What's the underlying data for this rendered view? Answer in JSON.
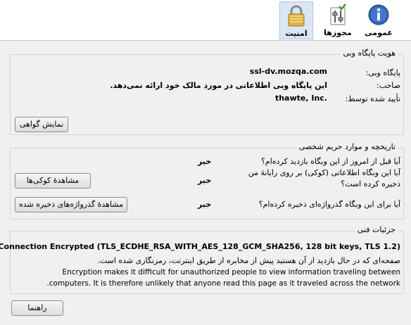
{
  "toolbar": {
    "general_label": "عمومی",
    "permissions_label": "مجوزها",
    "security_label": "امنیت"
  },
  "identity": {
    "legend": "هویت پایگاه وبی",
    "website_label": "پایگاه وبی:",
    "website_value": "ssl-dv.mozqa.com",
    "owner_label": "صاحب:",
    "owner_value": "این پایگاه وبی اطلاعاتی در مورد مالک خود ارائه نمی‌دهد.",
    "verified_label": "تأیید شده توسط:",
    "verified_value": "thawte, Inc.",
    "view_cert_button": "نمایش گواهی"
  },
  "privacy": {
    "legend": "تاریخچه و موارد حریم شخصی",
    "q1": "آیا قبل از امروز از این وبگاه بازدید کرده‌ام؟",
    "a1": "خیر",
    "q2_line1": "آیا این وبگاه اطلاعاتی (کوکی) بر روی رایانهٔ من",
    "q2_line2": "ذخیره کرده است؟",
    "a2": "خیر",
    "cookies_button": "مشاهدهٔ کوکی‌ها",
    "q3": "آیا برای این وبگاه گذرواژه‌ای ذخیره کرده‌ام؟",
    "a3": "خیر",
    "passwords_button": "مشاهدهٔ گذرواژه‌های ذخیره شده"
  },
  "technical": {
    "legend": "جزئیات فنی",
    "encryption_line": "Connection Encrypted (TLS_ECDHE_RSA_WITH_AES_128_GCM_SHA256, 128 bit keys, TLS 1.2)",
    "fa_line": "صفحه‌ای که در حال بازدید از آن هستید پیش از مخابره از طریق اینترنت، رمزنگاری شده است.",
    "en_line1": "Encryption makes it difficult for unauthorized people to view information traveling between",
    "en_line2": "computers. It is therefore unlikely that anyone read this page as it traveled across the network."
  },
  "help_button": "راهنما",
  "colors": {
    "selected_tab_bg": "#d8e6f6",
    "lock_gold": "#e0b33c",
    "info_blue": "#2f63b8"
  }
}
